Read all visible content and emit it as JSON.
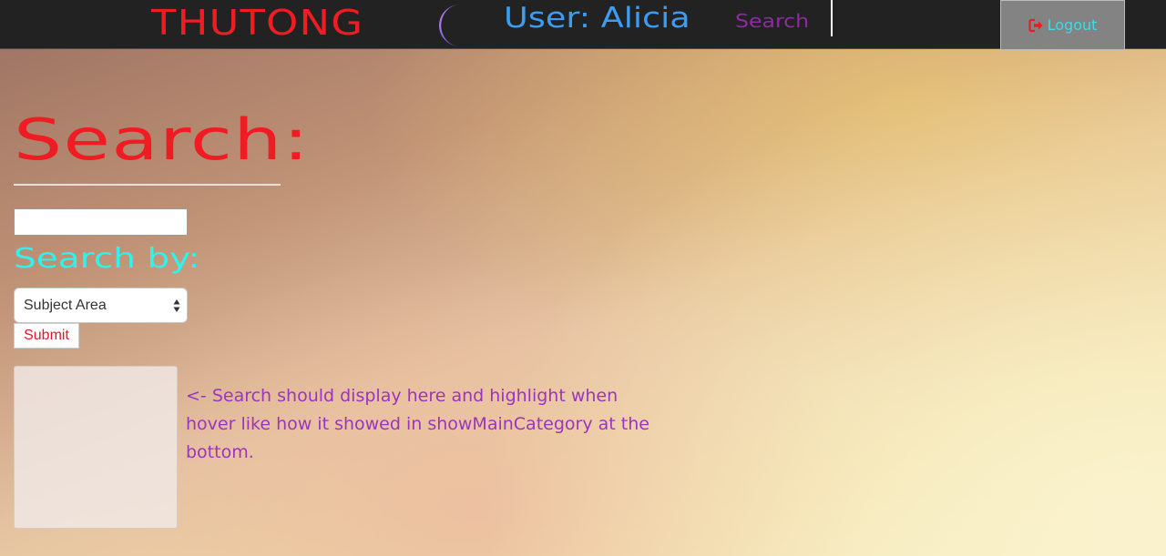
{
  "navbar": {
    "brand": "THUTONG",
    "user_label": "User: Alicia",
    "search_link": "Search",
    "logout_label": "Logout",
    "icons": {
      "logo": "crescent-logo-icon",
      "logout": "sign-out-icon"
    },
    "colors": {
      "background": "#222222",
      "brand": "#ef1c24",
      "user": "#3b9cf2",
      "search": "#8e2aa3",
      "logout_text": "#3fd9e8",
      "logout_icon": "#ef1c24"
    }
  },
  "main": {
    "title": "Search:",
    "search_input": {
      "value": "",
      "placeholder": ""
    },
    "search_by_label": "Search by:",
    "select": {
      "selected": "Subject Area"
    },
    "submit_label": "Submit",
    "note": "<- Search should display here and highlight when hover like how it showed in showMainCategory at the bottom.",
    "colors": {
      "title": "#ef1c24",
      "search_by": "#2ff2ee",
      "note": "#9b35c0",
      "submit": "#e8142c"
    }
  }
}
